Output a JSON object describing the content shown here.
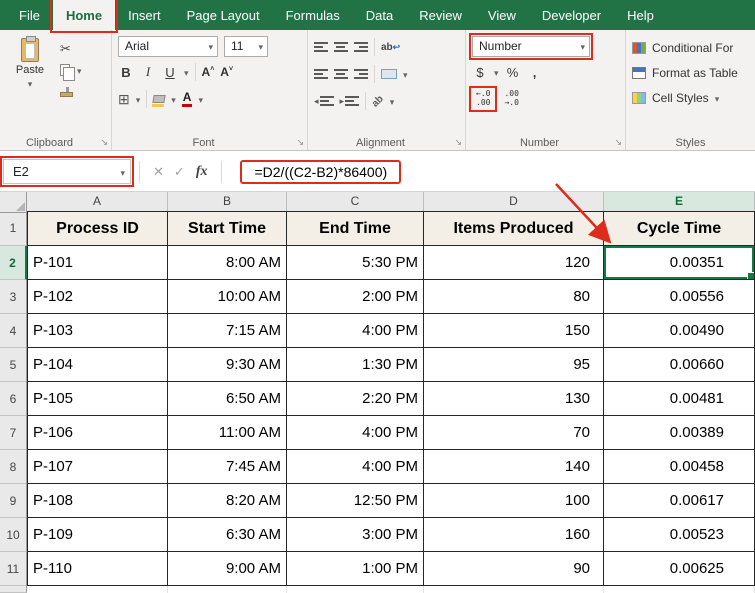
{
  "colors": {
    "excel_green": "#217346",
    "selection_green": "#107c41",
    "annotation_red": "#dd2b1c",
    "header_fill": "#f3efe6"
  },
  "menubar": {
    "tabs": [
      {
        "label": "File"
      },
      {
        "label": "Home",
        "active": true
      },
      {
        "label": "Insert"
      },
      {
        "label": "Page Layout"
      },
      {
        "label": "Formulas"
      },
      {
        "label": "Data"
      },
      {
        "label": "Review"
      },
      {
        "label": "View"
      },
      {
        "label": "Developer"
      },
      {
        "label": "Help"
      }
    ]
  },
  "ribbon": {
    "clipboard": {
      "paste_label": "Paste",
      "group_label": "Clipboard"
    },
    "font": {
      "font_name": "Arial",
      "font_size": "11",
      "bold": "B",
      "italic": "I",
      "underline": "U",
      "grow": "A",
      "shrink": "A",
      "font_color_letter": "A",
      "group_label": "Font"
    },
    "alignment": {
      "wrap_ab": "ab",
      "orientation_ab": "ab",
      "group_label": "Alignment"
    },
    "number": {
      "format_selected": "Number",
      "currency": "$",
      "percent": "%",
      "comma": ",",
      "increase_decimal": [
        "←.0",
        ".00"
      ],
      "decrease_decimal": [
        ".00",
        "→.0"
      ],
      "group_label": "Number"
    },
    "styles": {
      "conditional_formatting": "Conditional For",
      "format_as_table": "Format as Table",
      "cell_styles": "Cell Styles",
      "group_label": "Styles"
    }
  },
  "formula_bar": {
    "name_box": "E2",
    "cancel": "✕",
    "enter": "✓",
    "insert_function": "fx",
    "formula": "=D2/((C2-B2)*86400)"
  },
  "icons": {
    "paste": "clipboard",
    "cut": "scissors",
    "copy": "two-pages",
    "format_painter": "brush",
    "borders": "grid",
    "fill_color": "paint-bucket",
    "font_color": "letter-A-red-bar",
    "wrap_text": "ab-return-arrow",
    "merge_center": "merged-cell",
    "dialog_launcher": "corner-arrow",
    "select_all": "corner-triangle",
    "annotation_arrow": "red-arrow-to-E2"
  },
  "grid": {
    "columns": [
      "A",
      "B",
      "C",
      "D",
      "E"
    ],
    "selected": {
      "cell": "E2",
      "column": "E",
      "row": "2"
    },
    "rows": [
      {
        "num": "1",
        "header": true,
        "cells": [
          "Process ID",
          "Start Time",
          "End Time",
          "Items Produced",
          "Cycle Time"
        ]
      },
      {
        "num": "2",
        "cells": [
          "P-101",
          "8:00 AM",
          "5:30 PM",
          "120",
          "0.00351"
        ]
      },
      {
        "num": "3",
        "cells": [
          "P-102",
          "10:00 AM",
          "2:00 PM",
          "80",
          "0.00556"
        ]
      },
      {
        "num": "4",
        "cells": [
          "P-103",
          "7:15 AM",
          "4:00 PM",
          "150",
          "0.00490"
        ]
      },
      {
        "num": "5",
        "cells": [
          "P-104",
          "9:30 AM",
          "1:30 PM",
          "95",
          "0.00660"
        ]
      },
      {
        "num": "6",
        "cells": [
          "P-105",
          "6:50 AM",
          "2:20 PM",
          "130",
          "0.00481"
        ]
      },
      {
        "num": "7",
        "cells": [
          "P-106",
          "11:00 AM",
          "4:00 PM",
          "70",
          "0.00389"
        ]
      },
      {
        "num": "8",
        "cells": [
          "P-107",
          "7:45 AM",
          "4:00 PM",
          "140",
          "0.00458"
        ]
      },
      {
        "num": "9",
        "cells": [
          "P-108",
          "8:20 AM",
          "12:50 PM",
          "100",
          "0.00617"
        ]
      },
      {
        "num": "10",
        "cells": [
          "P-109",
          "6:30 AM",
          "3:00 PM",
          "160",
          "0.00523"
        ]
      },
      {
        "num": "11",
        "cells": [
          "P-110",
          "9:00 AM",
          "1:00 PM",
          "90",
          "0.00625"
        ]
      }
    ]
  }
}
